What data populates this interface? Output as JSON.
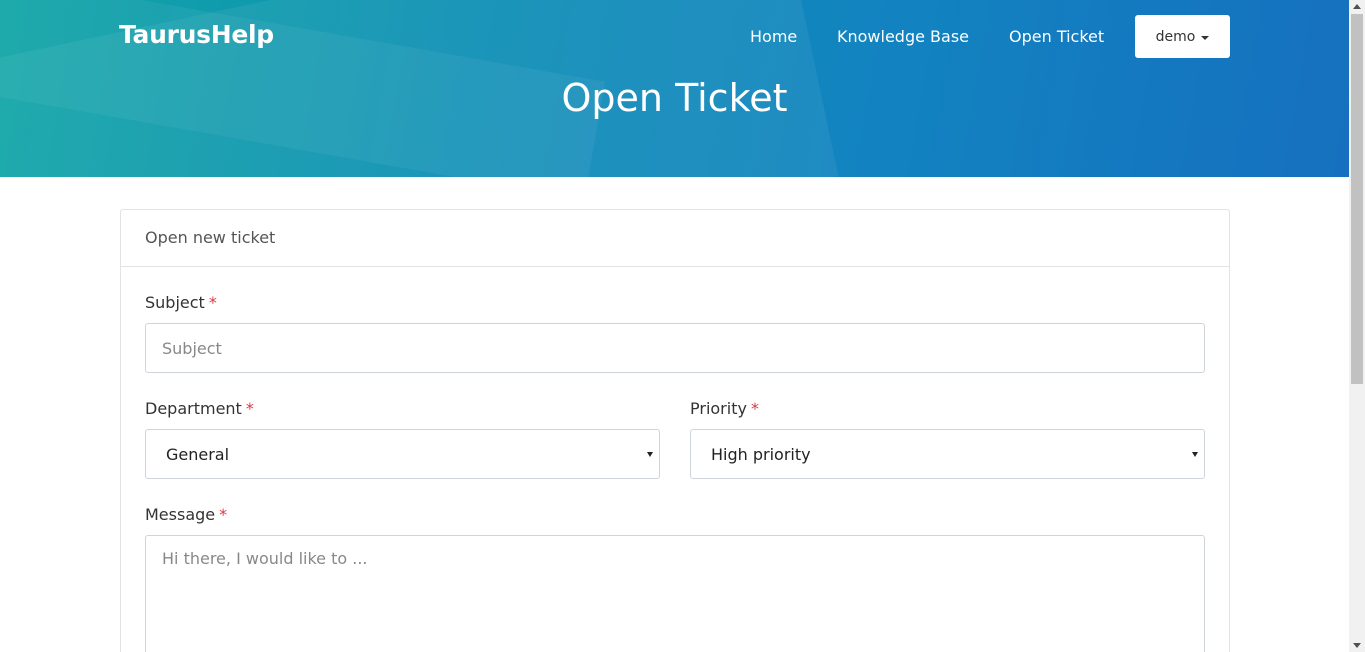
{
  "brand": "TaurusHelp",
  "nav": {
    "home": "Home",
    "knowledge_base": "Knowledge Base",
    "open_ticket": "Open Ticket",
    "user": "demo"
  },
  "page_title": "Open Ticket",
  "card": {
    "header": "Open new ticket",
    "subject": {
      "label": "Subject",
      "required": "*",
      "placeholder": "Subject"
    },
    "department": {
      "label": "Department",
      "required": "*",
      "value": "General"
    },
    "priority": {
      "label": "Priority",
      "required": "*",
      "value": "High priority"
    },
    "message": {
      "label": "Message",
      "required": "*",
      "placeholder": "Hi there, I would like to ..."
    }
  },
  "colors": {
    "header_gradient_start": "#12a6a6",
    "header_gradient_end": "#1670bf",
    "required_mark": "#dc3545"
  }
}
